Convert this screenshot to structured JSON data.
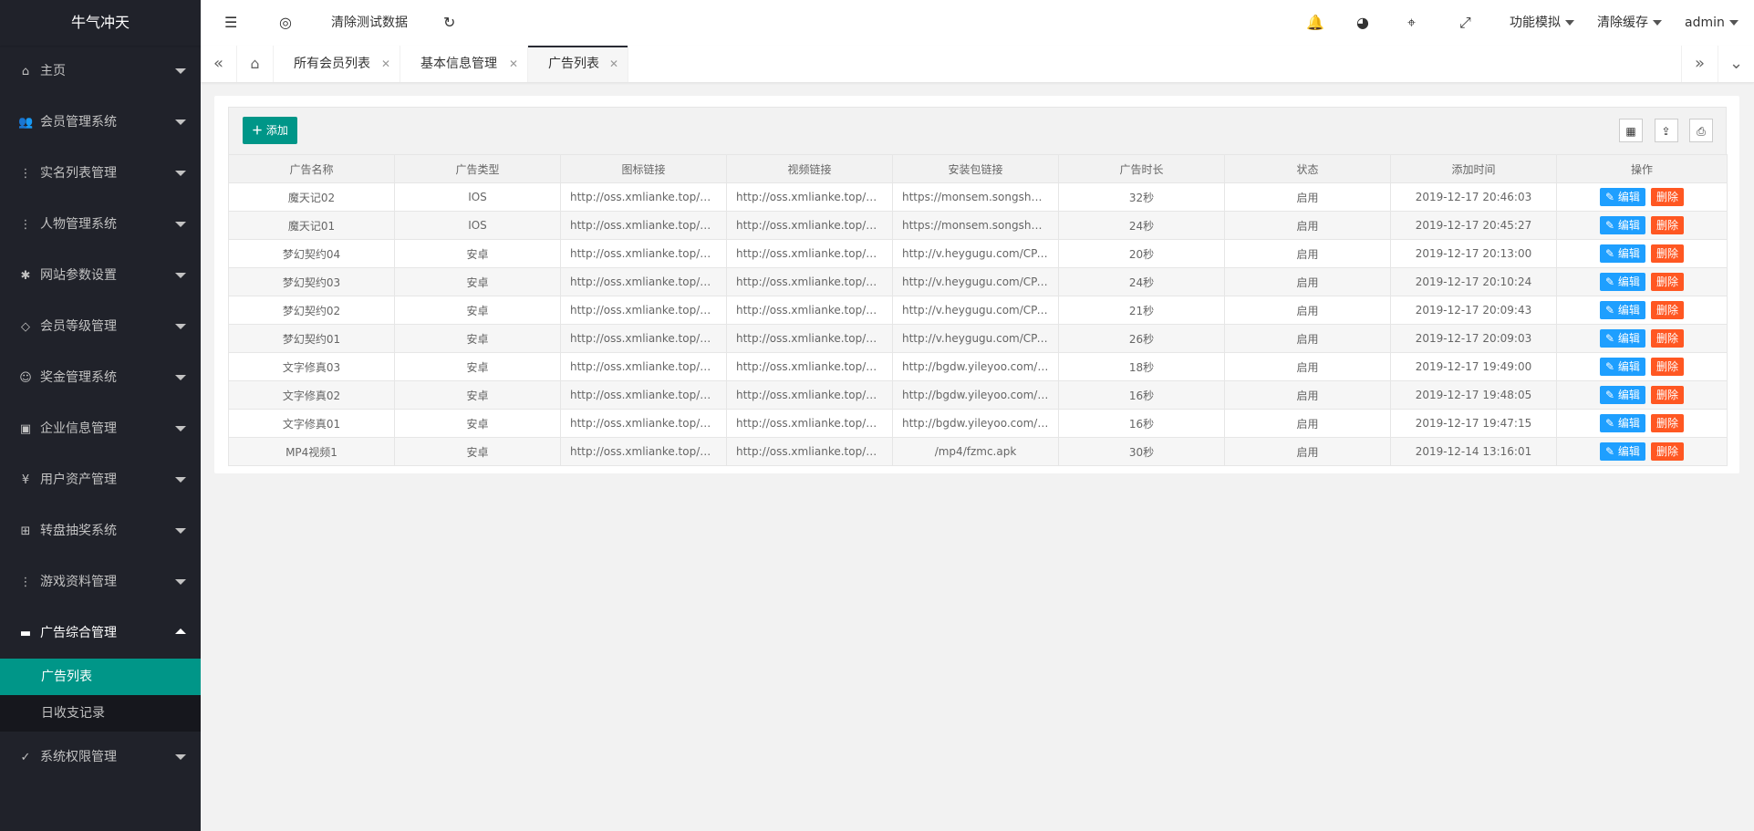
{
  "app": {
    "title": "牛气冲天"
  },
  "sidebar": {
    "items": [
      {
        "label": "主页",
        "icon": "home-icon",
        "glyph": "⌂"
      },
      {
        "label": "会员管理系统",
        "icon": "users-icon",
        "glyph": "👥"
      },
      {
        "label": "实名列表管理",
        "icon": "more-vertical-icon",
        "glyph": "⋮"
      },
      {
        "label": "人物管理系统",
        "icon": "more-vertical-icon",
        "glyph": "⋮"
      },
      {
        "label": "网站参数设置",
        "icon": "gear-icon",
        "glyph": "✱"
      },
      {
        "label": "会员等级管理",
        "icon": "diamond-icon",
        "glyph": "◇"
      },
      {
        "label": "奖金管理系统",
        "icon": "smile-icon",
        "glyph": "☺"
      },
      {
        "label": "企业信息管理",
        "icon": "form-icon",
        "glyph": "▣"
      },
      {
        "label": "用户资产管理",
        "icon": "rmb-icon",
        "glyph": "¥"
      },
      {
        "label": "转盘抽奖系统",
        "icon": "app-icon",
        "glyph": "⊞"
      },
      {
        "label": "游戏资料管理",
        "icon": "more-vertical-icon",
        "glyph": "⋮"
      },
      {
        "label": "广告综合管理",
        "icon": "ad-icon",
        "glyph": "▬"
      }
    ],
    "sub_items": [
      {
        "label": "广告列表"
      },
      {
        "label": "日收支记录"
      }
    ],
    "last_item": {
      "label": "系统权限管理",
      "icon": "shield-icon",
      "glyph": "✓"
    }
  },
  "header": {
    "clear_test_data": "清除测试数据",
    "function_sim": "功能模拟",
    "clear_cache": "清除缓存",
    "user": "admin"
  },
  "tabs": [
    {
      "label": "所有会员列表"
    },
    {
      "label": "基本信息管理"
    },
    {
      "label": "广告列表"
    }
  ],
  "toolbar": {
    "add_label": "添加"
  },
  "table": {
    "columns": [
      "广告名称",
      "广告类型",
      "图标链接",
      "视频链接",
      "安装包链接",
      "广告时长",
      "状态",
      "添加时间",
      "操作"
    ],
    "edit_label": "编辑",
    "delete_label": "删除",
    "rows": [
      [
        "魔天记02",
        "IOS",
        "http://oss.xmlianke.top/m...",
        "http://oss.xmlianke.top/m...",
        "https://monsem.songshug...",
        "32秒",
        "启用",
        "2019-12-17 20:46:03"
      ],
      [
        "魔天记01",
        "IOS",
        "http://oss.xmlianke.top/m...",
        "http://oss.xmlianke.top/m...",
        "https://monsem.songshug...",
        "24秒",
        "启用",
        "2019-12-17 20:45:27"
      ],
      [
        "梦幻契约04",
        "安卓",
        "http://oss.xmlianke.top/m...",
        "http://oss.xmlianke.top/m...",
        "http://v.heygugu.com/CPA...",
        "20秒",
        "启用",
        "2019-12-17 20:13:00"
      ],
      [
        "梦幻契约03",
        "安卓",
        "http://oss.xmlianke.top/m...",
        "http://oss.xmlianke.top/m...",
        "http://v.heygugu.com/CPA...",
        "24秒",
        "启用",
        "2019-12-17 20:10:24"
      ],
      [
        "梦幻契约02",
        "安卓",
        "http://oss.xmlianke.top/m...",
        "http://oss.xmlianke.top/m...",
        "http://v.heygugu.com/CPA...",
        "21秒",
        "启用",
        "2019-12-17 20:09:43"
      ],
      [
        "梦幻契约01",
        "安卓",
        "http://oss.xmlianke.top/m...",
        "http://oss.xmlianke.top/m...",
        "http://v.heygugu.com/CPA...",
        "26秒",
        "启用",
        "2019-12-17 20:09:03"
      ],
      [
        "文字修真03",
        "安卓",
        "http://oss.xmlianke.top/we...",
        "http://oss.xmlianke.top/we...",
        "http://bgdw.yileyoo.com/Yi...",
        "18秒",
        "启用",
        "2019-12-17 19:49:00"
      ],
      [
        "文字修真02",
        "安卓",
        "http://oss.xmlianke.top/we...",
        "http://oss.xmlianke.top/we...",
        "http://bgdw.yileyoo.com/Yi...",
        "16秒",
        "启用",
        "2019-12-17 19:48:05"
      ],
      [
        "文字修真01",
        "安卓",
        "http://oss.xmlianke.top/we...",
        "http://oss.xmlianke.top/we...",
        "http://bgdw.yileyoo.com/Yi...",
        "16秒",
        "启用",
        "2019-12-17 19:47:15"
      ],
      [
        "MP4视频1",
        "安卓",
        "http://oss.xmlianke.top/we...",
        "http://oss.xmlianke.top/%...",
        "/mp4/fzmc.apk",
        "30秒",
        "启用",
        "2019-12-14 13:16:01"
      ]
    ]
  },
  "colors": {
    "sidebar_bg": "#20222a",
    "accent": "#009688",
    "edit": "#1e9fff",
    "delete": "#ff5722"
  }
}
